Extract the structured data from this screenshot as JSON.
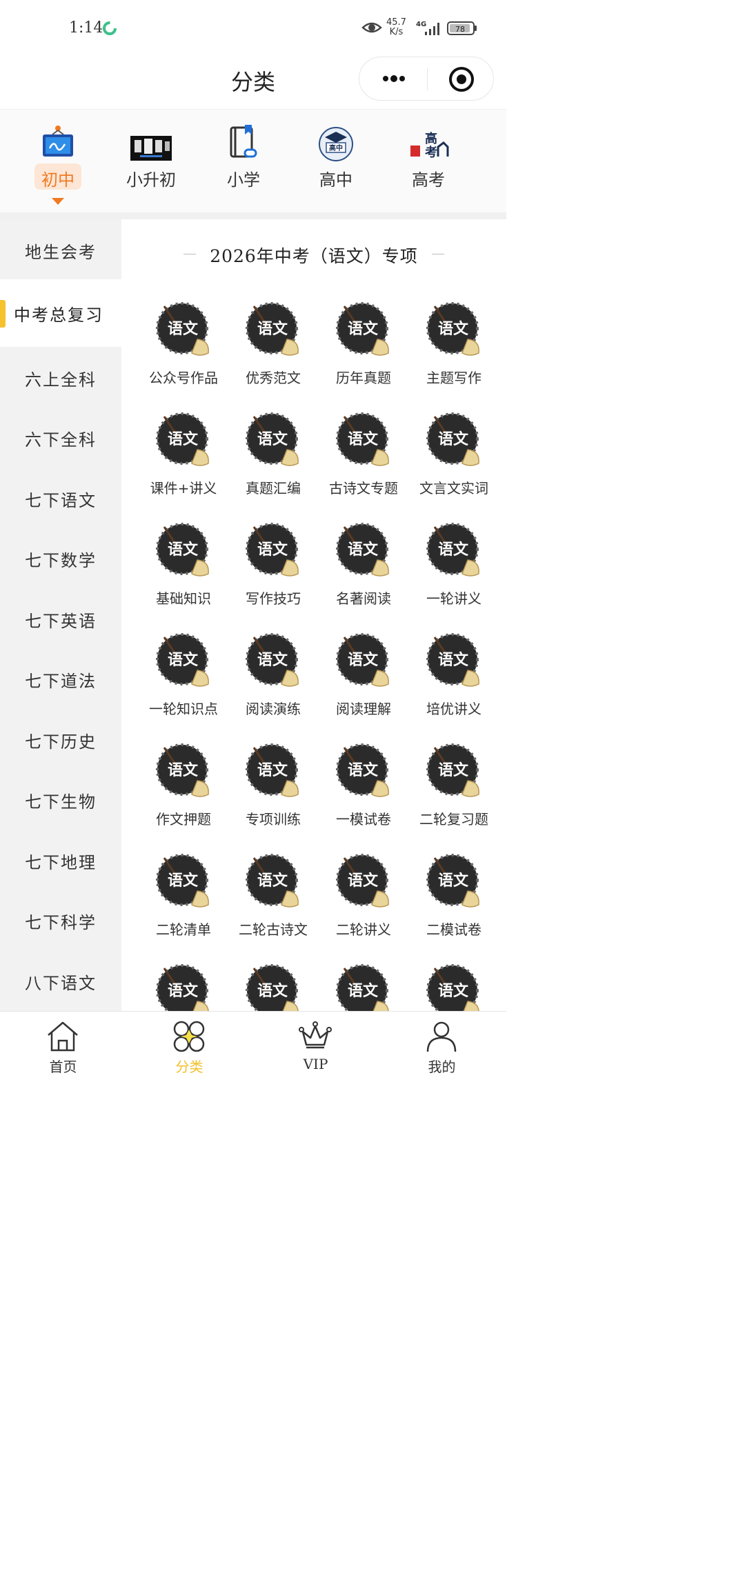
{
  "status": {
    "time": "1:14",
    "speed_value": "45.7",
    "speed_unit": "K/s",
    "network": "4G",
    "battery": "78"
  },
  "header": {
    "title": "分类"
  },
  "top_categories": [
    {
      "label": "初中",
      "icon": "monitor-icon",
      "active": true
    },
    {
      "label": "小升初",
      "icon": "banner-thumbnail-icon",
      "active": false
    },
    {
      "label": "小学",
      "icon": "book-link-icon",
      "active": false
    },
    {
      "label": "高中",
      "icon": "graduation-cap-badge-icon",
      "active": false
    },
    {
      "label": "高考",
      "icon": "gaokao-logo-icon",
      "active": false
    }
  ],
  "sidebar": {
    "items": [
      {
        "label": "地生会考",
        "active": false
      },
      {
        "label": "中考总复习",
        "active": true
      },
      {
        "label": "六上全科",
        "active": false
      },
      {
        "label": "六下全科",
        "active": false
      },
      {
        "label": "七下语文",
        "active": false
      },
      {
        "label": "七下数学",
        "active": false
      },
      {
        "label": "七下英语",
        "active": false
      },
      {
        "label": "七下道法",
        "active": false
      },
      {
        "label": "七下历史",
        "active": false
      },
      {
        "label": "七下生物",
        "active": false
      },
      {
        "label": "七下地理",
        "active": false
      },
      {
        "label": "七下科学",
        "active": false
      },
      {
        "label": "八下语文",
        "active": false
      }
    ]
  },
  "main": {
    "section_title": "2026年中考（语文）专项",
    "icon_text": "语文",
    "items": [
      "公众号作品",
      "优秀范文",
      "历年真题",
      "主题写作",
      "课件+讲义",
      "真题汇编",
      "古诗文专题",
      "文言文实词",
      "基础知识",
      "写作技巧",
      "名著阅读",
      "一轮讲义",
      "一轮知识点",
      "阅读演练",
      "阅读理解",
      "培优讲义",
      "作文押题",
      "专项训练",
      "一模试卷",
      "二轮复习题",
      "二轮清单",
      "二轮古诗文",
      "二轮讲义",
      "二模试卷",
      "",
      "",
      "",
      ""
    ]
  },
  "tabbar": {
    "items": [
      {
        "label": "首页",
        "icon": "home-icon",
        "active": false
      },
      {
        "label": "分类",
        "icon": "category-icon",
        "active": true
      },
      {
        "label": "VIP",
        "icon": "crown-icon",
        "active": false
      },
      {
        "label": "我的",
        "icon": "user-icon",
        "active": false
      }
    ]
  },
  "colors": {
    "accent_orange": "#f07a22",
    "accent_yellow": "#f5c22e"
  }
}
